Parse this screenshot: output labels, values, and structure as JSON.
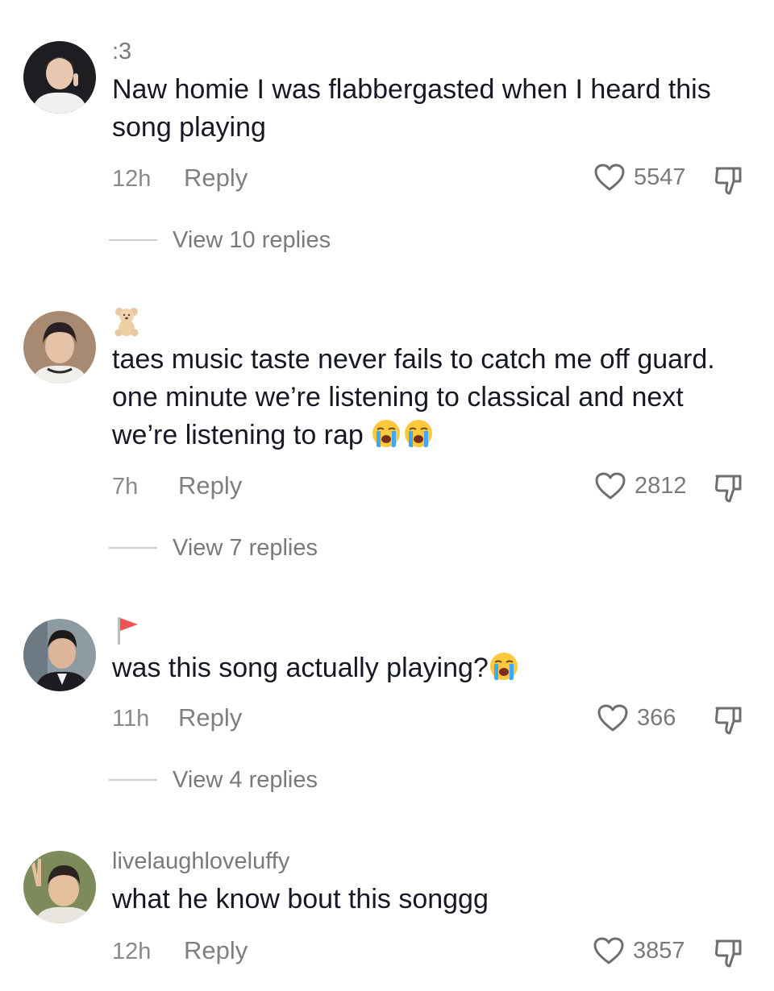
{
  "comments": [
    {
      "username": ":3",
      "username_icon": null,
      "text": "Naw homie I was flabbergasted when I heard this song playing",
      "emoji_count": 0,
      "time": "12h",
      "reply_label": "Reply",
      "likes": "5547",
      "view_replies": "View 10 replies"
    },
    {
      "username": "",
      "username_icon": "teddy-bear-icon",
      "text": "taes music taste never fails to catch me off guard. one minute we’re listening to classical and next we’re listening to rap",
      "emoji": "loudly-crying-face-icon",
      "emoji_count": 2,
      "time": "7h",
      "reply_label": "Reply",
      "likes": "2812",
      "view_replies": "View 7 replies"
    },
    {
      "username": "",
      "username_icon": "red-flag-icon",
      "text": "was this song actually playing?",
      "emoji": "loudly-crying-face-icon",
      "emoji_count": 1,
      "time": "11h",
      "reply_label": "Reply",
      "likes": "366",
      "view_replies": "View 4 replies"
    },
    {
      "username": "livelaughloveluffy",
      "username_icon": null,
      "text": "what he know bout this songgg",
      "emoji_count": 0,
      "time": "12h",
      "reply_label": "Reply",
      "likes": "3857"
    }
  ],
  "colors": {
    "primary_text": "#161823",
    "secondary_text": "#7a7a7a",
    "divider": "#d0d0d0",
    "emoji_yellow": "#ffc83d",
    "emoji_tear": "#3fa9f5",
    "flag_red": "#f05454"
  }
}
